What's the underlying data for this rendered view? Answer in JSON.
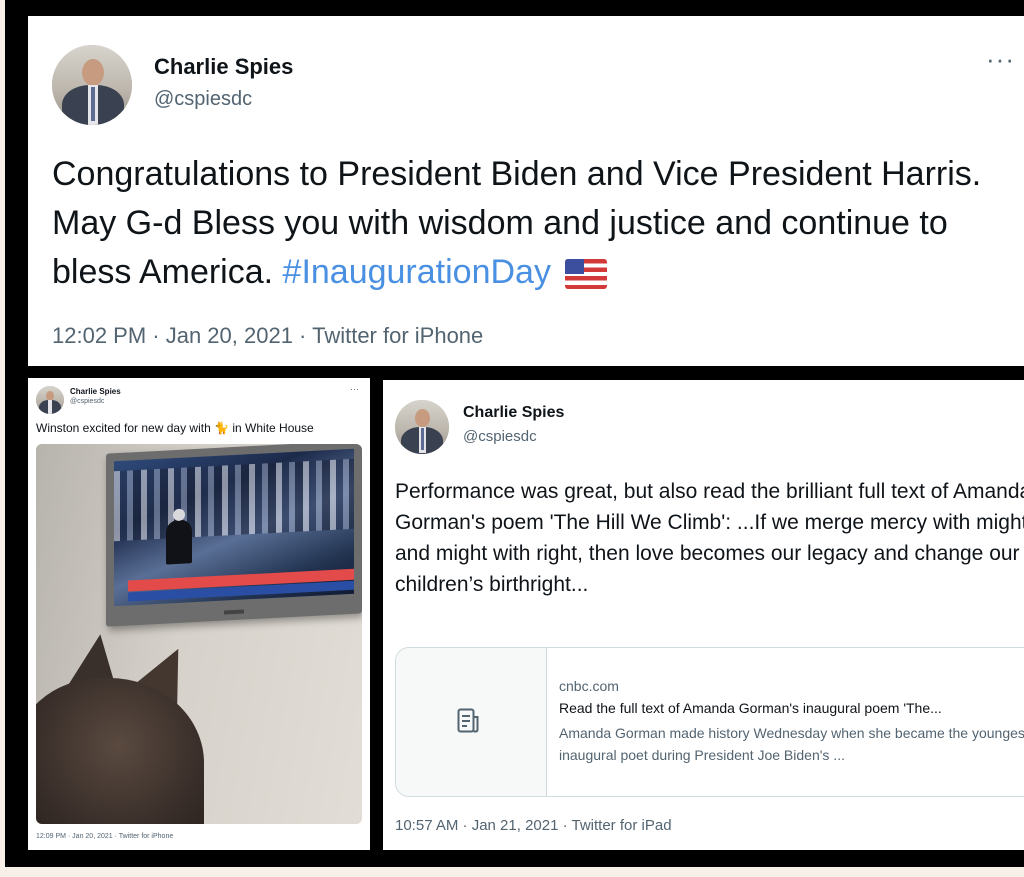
{
  "tweet_main": {
    "name": "Charlie Spies",
    "handle": "@cspiesdc",
    "more": "···",
    "text_before_tag": "Congratulations to President Biden and Vice President Harris.  May G-d Bless you with wisdom and justice and continue to bless America. ",
    "hashtag": "#InaugurationDay",
    "emoji": "us-flag-emoji",
    "meta": "12:02 PM · Jan 20, 2021 · Twitter for iPhone"
  },
  "tweet_photo": {
    "name": "Charlie Spies",
    "handle": "@cspiesdc",
    "more": "···",
    "text_before_emoji": "Winston excited for new day with ",
    "emoji": "🐈",
    "text_after_emoji": " in White House",
    "meta": "12:09 PM · Jan 20, 2021 · Twitter for iPhone"
  },
  "tweet_poem": {
    "name": "Charlie Spies",
    "handle": "@cspiesdc",
    "text": "Performance was great, but also read the brilliant full text of Amanda Gorman's poem 'The Hill We Climb': ...If we merge mercy with might, and might with right, then love becomes our legacy and change our children’s birthright...",
    "link_card": {
      "domain": "cnbc.com",
      "title": "Read the full text of Amanda Gorman's inaugural poem 'The...",
      "description": "Amanda Gorman made history Wednesday when she became the youngest inaugural poet during President Joe Biden's ...",
      "icon": "document-icon"
    },
    "meta": "10:57 AM · Jan 21, 2021 · Twitter for iPad"
  },
  "colors": {
    "frame": "#000000",
    "link": "#4a90e2",
    "secondary_text": "#536471"
  }
}
